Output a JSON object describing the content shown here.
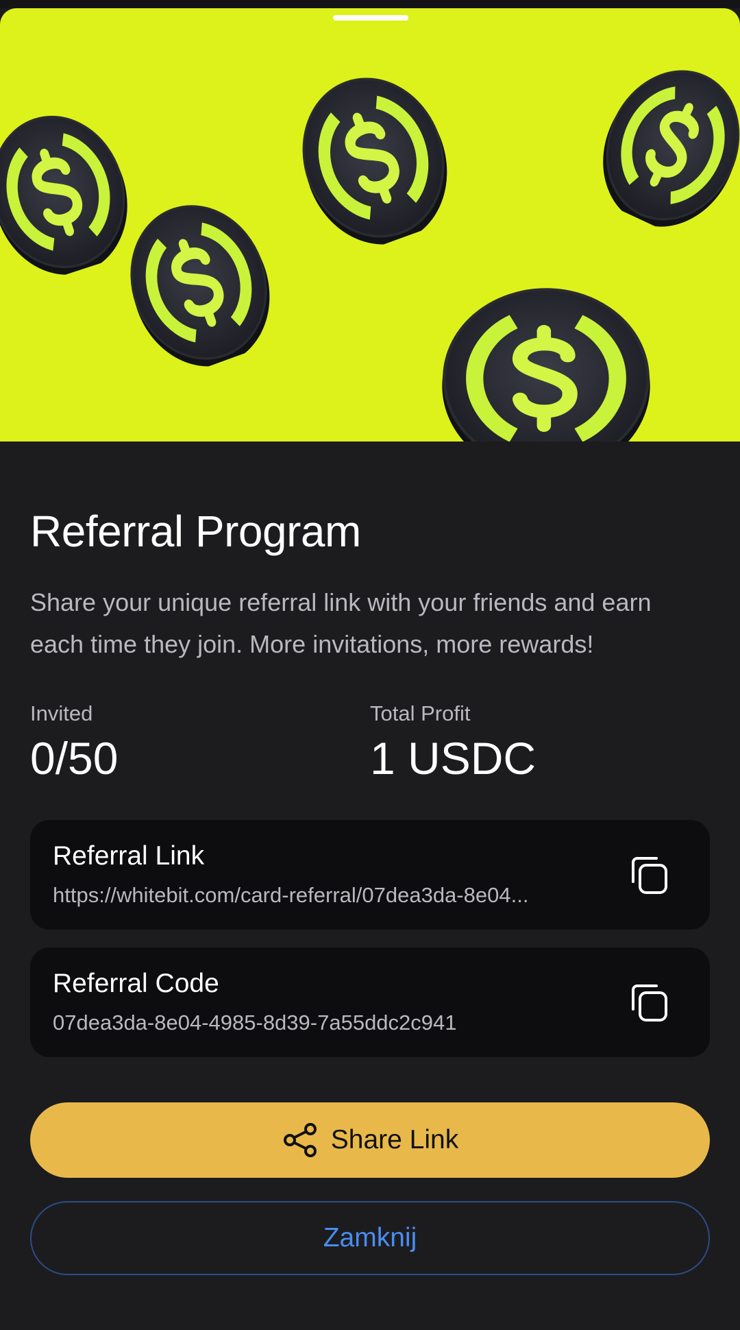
{
  "sheet": {
    "title": "Referral Program",
    "description": "Share your unique referral link with your friends and earn each time they join. More invitations, more rewards!",
    "hero_icon": "dollar-coin",
    "hero_color": "#dcf21a"
  },
  "stats": {
    "invited_label": "Invited",
    "invited_value": "0/50",
    "profit_label": "Total Profit",
    "profit_value": "1 USDC"
  },
  "referral_link": {
    "label": "Referral Link",
    "value": "https://whitebit.com/card-referral/07dea3da-8e04..."
  },
  "referral_code": {
    "label": "Referral Code",
    "value": "07dea3da-8e04-4985-8d39-7a55ddc2c941"
  },
  "actions": {
    "share_label": "Share Link",
    "close_label": "Zamknij",
    "share_color": "#e8b94a",
    "close_color": "#4a8df0"
  }
}
